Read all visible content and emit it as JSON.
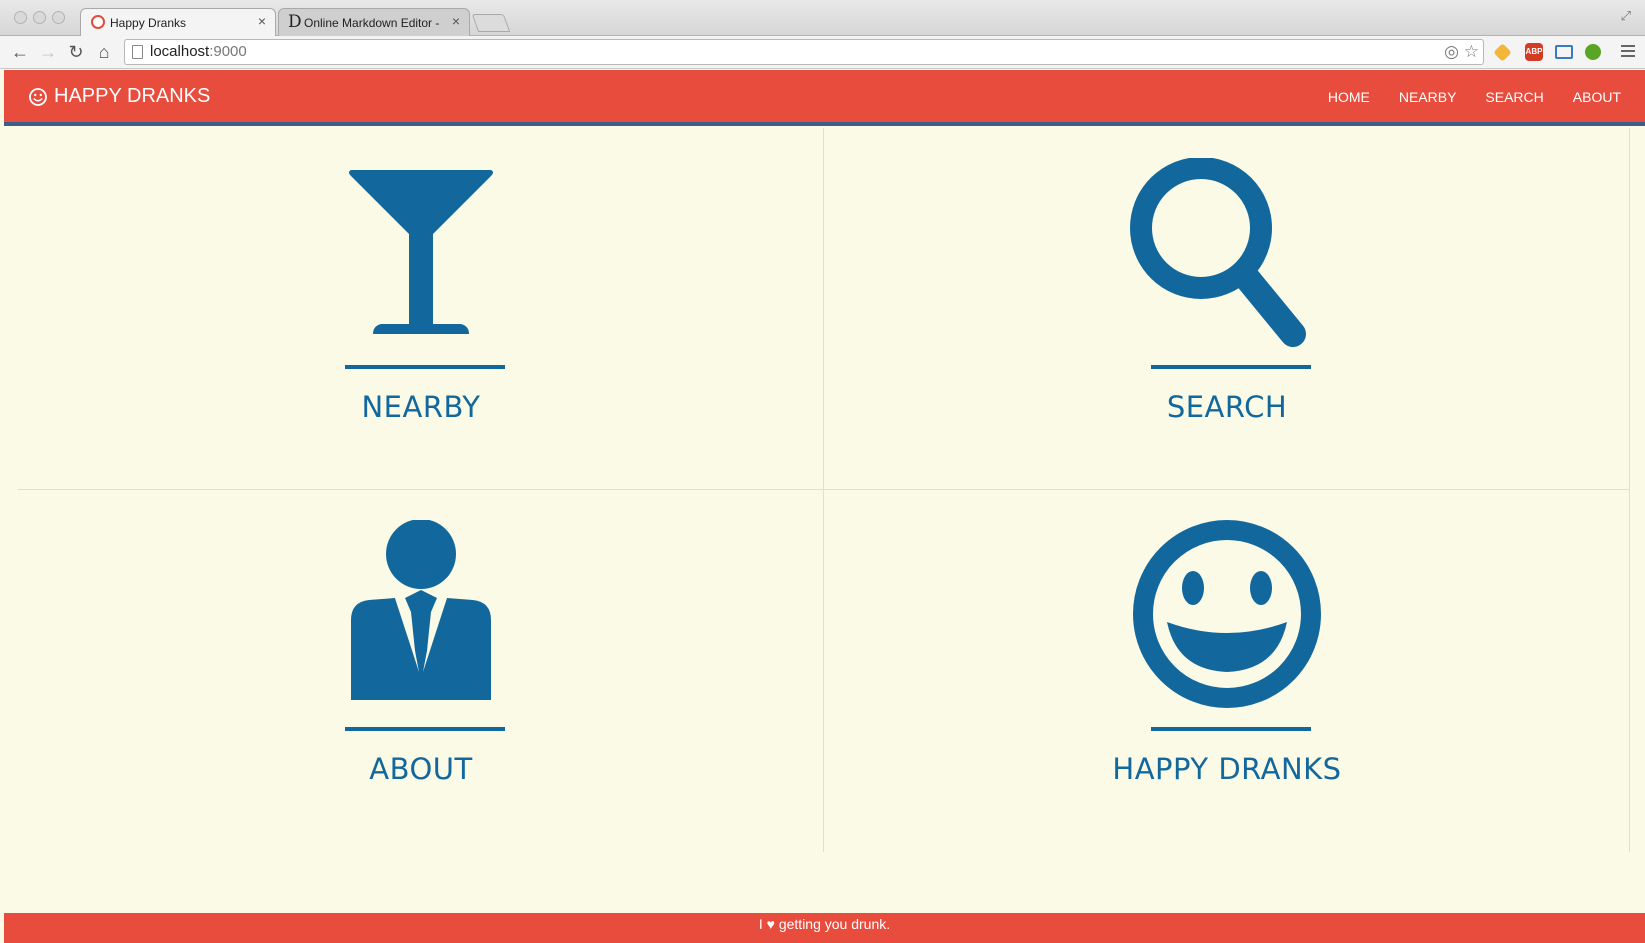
{
  "browser": {
    "tabs": [
      {
        "title": "Happy Dranks",
        "active": true
      },
      {
        "title": "Online Markdown Editor -",
        "active": false
      }
    ],
    "url_host": "localhost",
    "url_port": ":9000"
  },
  "navbar": {
    "brand": "HAPPY DRANKS",
    "links": [
      "HOME",
      "NEARBY",
      "SEARCH",
      "ABOUT"
    ]
  },
  "tiles": [
    {
      "label": "NEARBY",
      "icon": "cocktail-glass-icon"
    },
    {
      "label": "SEARCH",
      "icon": "magnifier-icon"
    },
    {
      "label": "ABOUT",
      "icon": "person-suit-icon"
    },
    {
      "label": "HAPPY DRANKS",
      "icon": "smiley-icon"
    }
  ],
  "footer": {
    "text": "I ♥ getting you drunk."
  },
  "colors": {
    "accent": "#e84c3d",
    "icon_blue": "#12689d",
    "background": "#fafae6",
    "nav_border": "#3c5f8a"
  }
}
